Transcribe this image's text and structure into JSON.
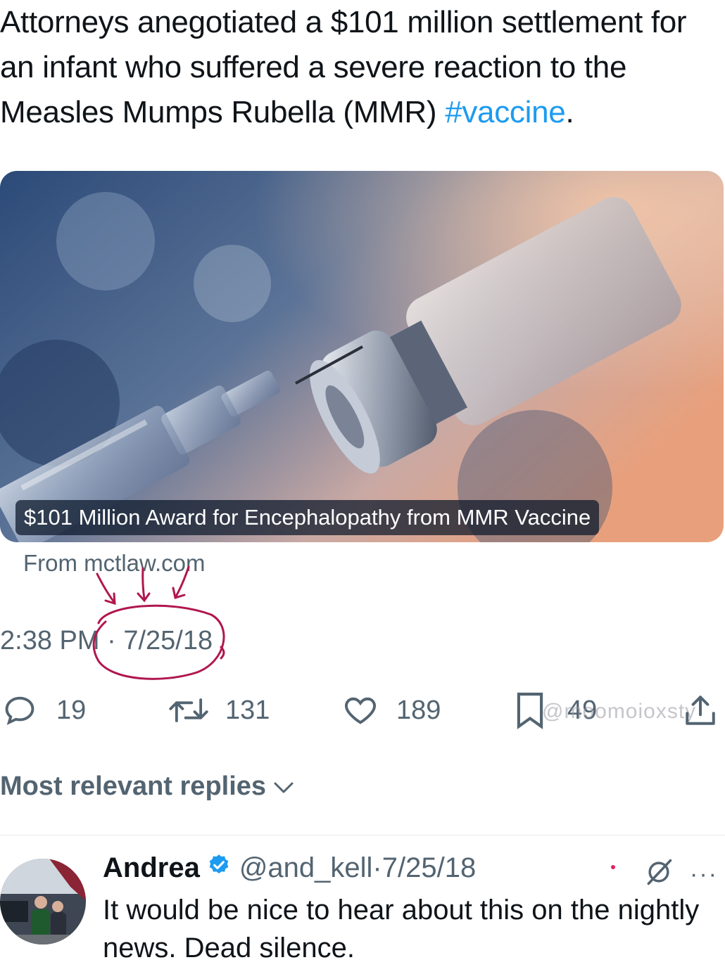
{
  "tweet": {
    "text": "Attorneys anegotiated a $101 million settlement for an infant who suffered a severe reaction to the Measles Mumps Rubella (MMR) ",
    "hashtag": "#vaccine",
    "end_punct": "."
  },
  "card": {
    "caption": "$101 Million Award for Encephalopathy from MMR Vaccine",
    "source": "From mctlaw.com"
  },
  "timestamp": {
    "time": "2:38 PM",
    "separator": " · ",
    "date": "7/25/18"
  },
  "actions": {
    "replies": "19",
    "reposts": "131",
    "likes": "189",
    "bookmarks": "49"
  },
  "watermark": "@moomoioxsty",
  "replies_header": {
    "label": "Most relevant replies"
  },
  "reply": {
    "name": "Andrea",
    "handle": "@and_kell",
    "separator": " · ",
    "date": "7/25/18",
    "text": "It would be nice to hear about this on the nightly news. Dead silence.",
    "more": "···"
  },
  "colors": {
    "accent": "#1d9bf0",
    "muted": "#536471",
    "annotation": "#b0174f",
    "verified": "#1d9bf0"
  }
}
